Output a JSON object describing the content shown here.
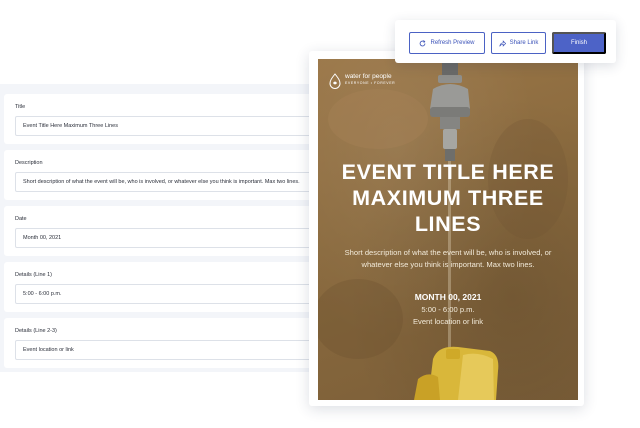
{
  "toolbar": {
    "refresh_label": "Refresh Preview",
    "share_label": "Share Link",
    "finish_label": "Finish",
    "refresh_icon": "refresh-icon",
    "share_icon": "share-icon"
  },
  "form": {
    "fields": [
      {
        "label": "Title",
        "value": "Event Title Here Maximum Three Lines"
      },
      {
        "label": "Description",
        "value": "Short description of what the event will be, who is involved, or whatever else you think is important. Max two lines."
      },
      {
        "label": "Date",
        "value": "Month 00, 2021"
      },
      {
        "label": "Details (Line 1)",
        "value": "5:00 - 6:00 p.m."
      },
      {
        "label": "Details (Line 2-3)",
        "value": "Event location or link"
      }
    ]
  },
  "poster": {
    "logo_name": "water for people",
    "logo_tagline": "EVERYONE • FOREVER",
    "title": "Event Title Here Maximum Three Lines",
    "description": "Short description of what the event will be, who is involved, or whatever else you think is important. Max two lines.",
    "date": "MONTH 00, 2021",
    "detail_line1": "5:00 - 6:00 p.m.",
    "detail_line2": "Event location or link",
    "background_image": "water-tap-photo"
  },
  "colors": {
    "accent": "#4d63c7",
    "form_bg": "#f3f5f9",
    "poster_bg": "#8a6a3e"
  }
}
